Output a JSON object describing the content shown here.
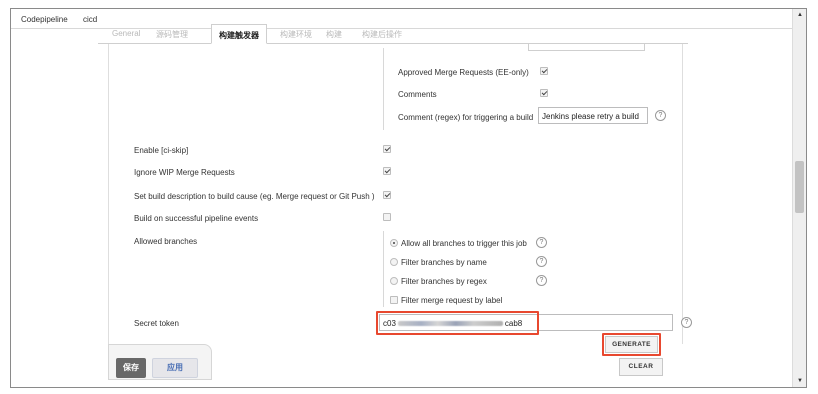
{
  "breadcrumb": [
    "Codepipeline",
    "cicd"
  ],
  "tabs": [
    "General",
    "源码管理",
    "构建触发器",
    "构建环境",
    "构建",
    "构建后操作"
  ],
  "active_tab_index": 2,
  "merge_options": {
    "approved_mr": {
      "label": "Approved Merge Requests (EE-only)",
      "checked": true
    },
    "comments": {
      "label": "Comments",
      "checked": true
    },
    "comment_regex": {
      "label": "Comment (regex) for triggering a build",
      "value": "Jenkins please retry a build"
    }
  },
  "options": [
    {
      "label": "Enable [ci-skip]",
      "checked": true
    },
    {
      "label": "Ignore WIP Merge Requests",
      "checked": true
    },
    {
      "label": "Set build description to build cause (eg. Merge request or Git Push )",
      "checked": true
    },
    {
      "label": "Build on successful pipeline events",
      "checked": false
    }
  ],
  "allowed_branches": {
    "label": "Allowed branches",
    "radios": [
      {
        "label": "Allow all branches to trigger this job",
        "selected": true
      },
      {
        "label": "Filter branches by name",
        "selected": false
      },
      {
        "label": "Filter branches by regex",
        "selected": false
      }
    ],
    "filter_label": {
      "label": "Filter merge request by label",
      "checked": false
    }
  },
  "secret_token": {
    "label": "Secret token",
    "prefix": "c03",
    "suffix": "cab8"
  },
  "buttons": {
    "generate": "GENERATE",
    "clear": "CLEAR",
    "save": "保存",
    "apply": "应用"
  },
  "icons": {
    "help": "help-circle-icon",
    "scroll_up": "triangle-up-icon",
    "scroll_down": "triangle-down-icon"
  },
  "colors": {
    "highlight": "#e8482f",
    "save_bg": "#686868",
    "apply_text": "#4a6fb5"
  }
}
